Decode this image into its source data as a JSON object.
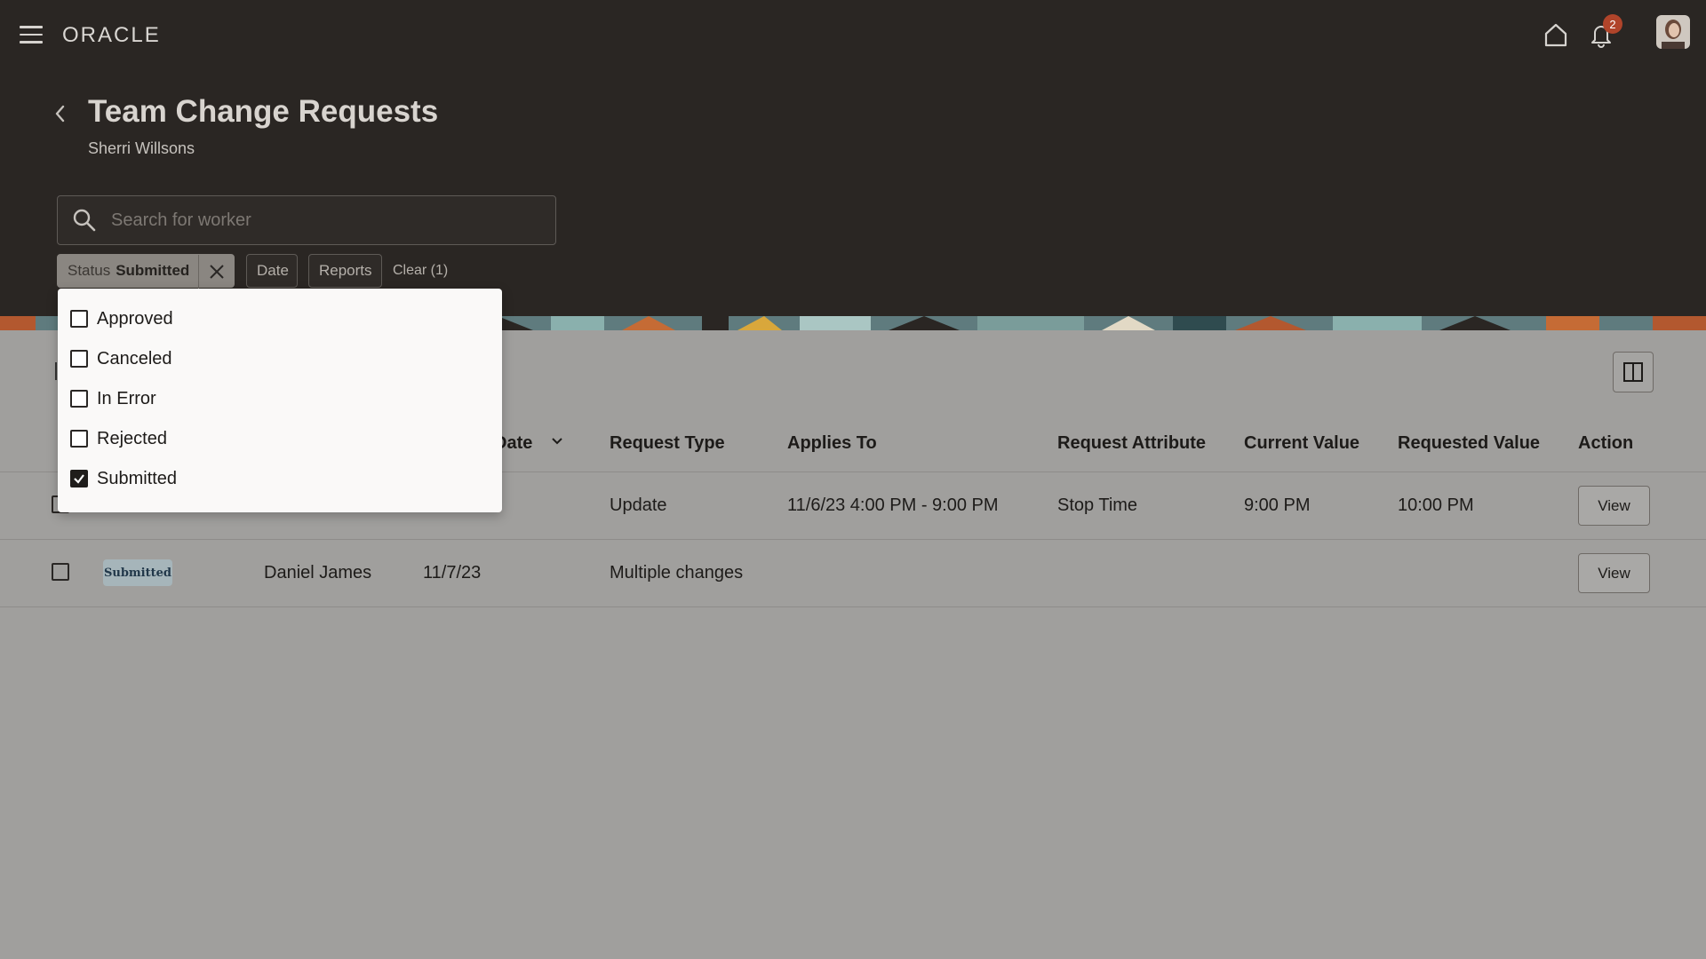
{
  "header": {
    "logo": "ORACLE",
    "notification_count": "2",
    "title": "Team Change Requests",
    "subtitle": "Sherri Willsons"
  },
  "search": {
    "placeholder": "Search for worker",
    "value": ""
  },
  "filters": {
    "status_label": "Status",
    "status_value": "Submitted",
    "date_label": "Date",
    "reports_label": "Reports",
    "clear_label": "Clear (1)"
  },
  "dropdown": {
    "options": [
      {
        "label": "Approved",
        "checked": false
      },
      {
        "label": "Canceled",
        "checked": false
      },
      {
        "label": "In Error",
        "checked": false
      },
      {
        "label": "Rejected",
        "checked": false
      },
      {
        "label": "Submitted",
        "checked": true
      }
    ]
  },
  "table": {
    "columns": {
      "date_partial": "Date",
      "request_type": "Request Type",
      "applies_to": "Applies To",
      "request_attribute": "Request Attribute",
      "current_value": "Current Value",
      "requested_value": "Requested Value",
      "action": "Action"
    },
    "rows": [
      {
        "request_type": "Update",
        "applies_to": "11/6/23 4:00 PM - 9:00 PM",
        "request_attribute": "Stop Time",
        "current_value": "9:00 PM",
        "requested_value": "10:00 PM",
        "action": "View"
      },
      {
        "status": "Submitted",
        "worker": "Daniel James",
        "date": "11/7/23",
        "request_type": "Multiple changes",
        "applies_to": "",
        "request_attribute": "",
        "current_value": "",
        "requested_value": "",
        "action": "View"
      }
    ]
  },
  "colors": {
    "header_bg": "#2a2623",
    "content_bg": "#a09f9d",
    "badge_bg": "#b0442a",
    "status_badge_bg": "#a6b5ba"
  }
}
